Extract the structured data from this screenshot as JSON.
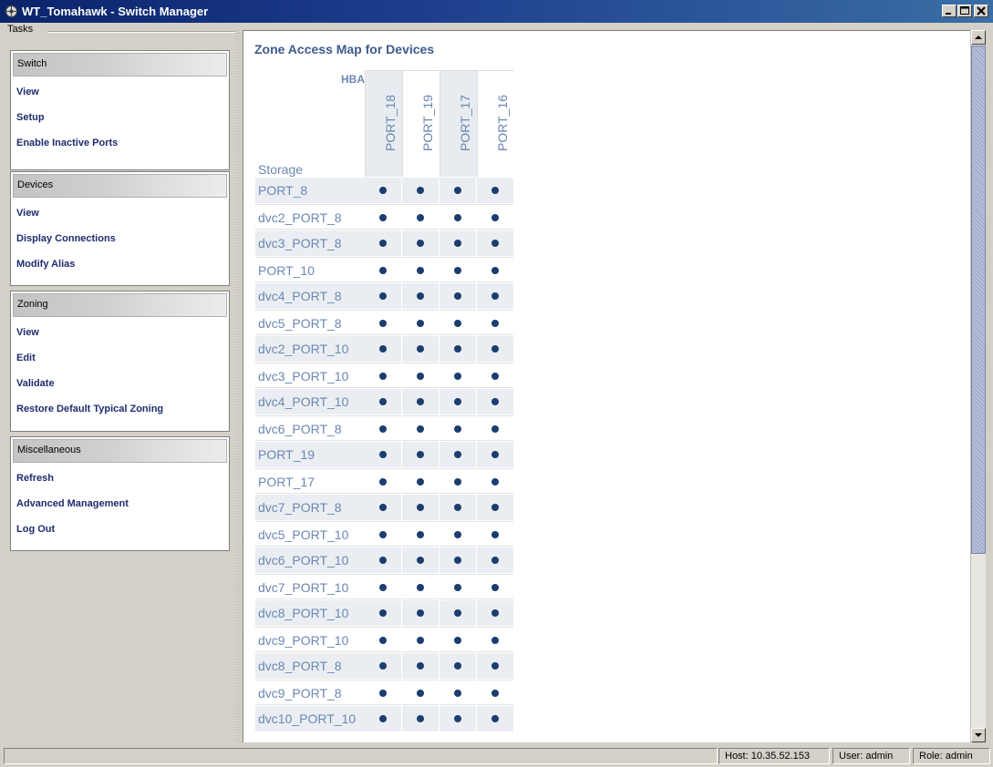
{
  "window": {
    "title": "WT_Tomahawk - Switch Manager"
  },
  "tasks": {
    "legend": "Tasks",
    "groups": [
      {
        "header": "Switch",
        "items": [
          "View",
          "Setup",
          "Enable Inactive Ports"
        ]
      },
      {
        "header": "Devices",
        "items": [
          "View",
          "Display Connections",
          "Modify Alias"
        ]
      },
      {
        "header": "Zoning",
        "items": [
          "View",
          "Edit",
          "Validate",
          "Restore Default Typical Zoning"
        ]
      },
      {
        "header": "Miscellaneous",
        "items": [
          "Refresh",
          "Advanced Management",
          "Log Out"
        ]
      }
    ]
  },
  "content": {
    "title": "Zone Access Map for Devices",
    "hba_label": "HBA",
    "storage_label": "Storage",
    "hba_ports": [
      "PORT_18",
      "PORT_19",
      "PORT_17",
      "PORT_16"
    ],
    "storage_rows": [
      "PORT_8",
      "dvc2_PORT_8",
      "dvc3_PORT_8",
      "PORT_10",
      "dvc4_PORT_8",
      "dvc5_PORT_8",
      "dvc2_PORT_10",
      "dvc3_PORT_10",
      "dvc4_PORT_10",
      "dvc6_PORT_8",
      "PORT_19",
      "PORT_17",
      "dvc7_PORT_8",
      "dvc5_PORT_10",
      "dvc6_PORT_10",
      "dvc7_PORT_10",
      "dvc8_PORT_10",
      "dvc9_PORT_10",
      "dvc8_PORT_8",
      "dvc9_PORT_8",
      "dvc10_PORT_10"
    ],
    "access_marker": "•"
  },
  "status": {
    "host": "Host: 10.35.52.153",
    "user": "User: admin",
    "role": "Role: admin"
  },
  "colors": {
    "title_bar": "#0a246a",
    "link_text": "#1e2c6e",
    "matrix_text": "#6b87b3",
    "dot": "#1c3d6e"
  }
}
